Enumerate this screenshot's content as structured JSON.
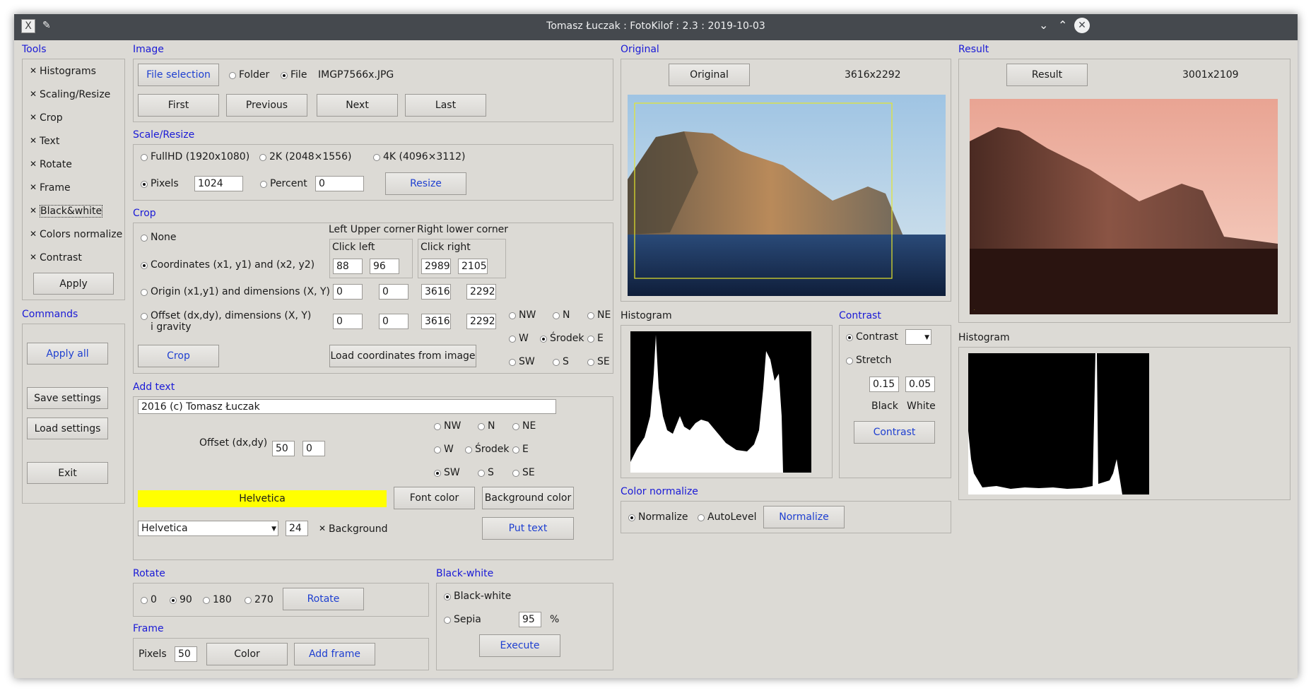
{
  "titlebar": {
    "title": "Tomasz Łuczak : FotoKilof : 2.3 : 2019-10-03"
  },
  "tools": {
    "heading": "Tools",
    "items": [
      "Histograms",
      "Scaling/Resize",
      "Crop",
      "Text",
      "Rotate",
      "Frame",
      "Black&white",
      "Colors normalize",
      "Contrast"
    ],
    "apply": "Apply"
  },
  "commands": {
    "heading": "Commands",
    "apply_all": "Apply all",
    "save_settings": "Save settings",
    "load_settings": "Load settings",
    "exit": "Exit"
  },
  "image": {
    "heading": "Image",
    "file_selection": "File selection",
    "folder": "Folder",
    "file": "File",
    "filename": "IMGP7566x.JPG",
    "first": "First",
    "previous": "Previous",
    "next": "Next",
    "last": "Last"
  },
  "scale": {
    "heading": "Scale/Resize",
    "fullhd": "FullHD (1920x1080)",
    "k2": "2K (2048×1556)",
    "k4": "4K (4096×3112)",
    "pixels": "Pixels",
    "pixels_value": "1024",
    "percent": "Percent",
    "percent_value": "0",
    "resize": "Resize"
  },
  "crop": {
    "heading": "Crop",
    "left_upper": "Left Upper corner",
    "right_lower": "Right lower corner",
    "click_left": "Click left",
    "click_right": "Click right",
    "none": "None",
    "coords": "Coordinates (x1, y1) and (x2, y2)",
    "origin": "Origin (x1,y1) and dimensions (X, Y)",
    "offset1": "Offset (dx,dy), dimensions (X, Y)",
    "offset2": "i gravity",
    "c_x1": "88",
    "c_y1": "96",
    "c_x2": "2989",
    "c_y2": "2105",
    "o_x": "0",
    "o_y": "0",
    "o_w": "3616",
    "o_h": "2292",
    "f_x": "0",
    "f_y": "0",
    "f_w": "3616",
    "f_h": "2292",
    "gravity": [
      "NW",
      "N",
      "NE",
      "W",
      "Środek",
      "E",
      "SW",
      "S",
      "SE"
    ],
    "crop_btn": "Crop",
    "load_coords": "Load coordinates from image"
  },
  "text": {
    "heading": "Add text",
    "value": "2016 (c) Tomasz Łuczak",
    "offset": "Offset (dx,dy)",
    "dx": "50",
    "dy": "0",
    "gravity": [
      "NW",
      "N",
      "NE",
      "W",
      "Środek",
      "E",
      "SW",
      "S",
      "SE"
    ],
    "font_preview": "Helvetica",
    "font_color": "Font color",
    "background_color": "Background color",
    "font": "Helvetica",
    "size": "24",
    "background": "Background",
    "put_text": "Put text"
  },
  "rotate": {
    "heading": "Rotate",
    "options": [
      "0",
      "90",
      "180",
      "270"
    ],
    "rotate": "Rotate"
  },
  "frame": {
    "heading": "Frame",
    "pixels": "Pixels",
    "value": "50",
    "color": "Color",
    "add": "Add frame"
  },
  "bw": {
    "heading": "Black-white",
    "bw": "Black-white",
    "sepia": "Sepia",
    "sepia_value": "95",
    "percent": "%",
    "execute": "Execute"
  },
  "original": {
    "heading": "Original",
    "button": "Original",
    "size": "3616x2292",
    "histogram": "Histogram"
  },
  "contrast": {
    "heading": "Contrast",
    "contrast": "Contrast",
    "stretch": "Stretch",
    "black_value": "0.15",
    "white_value": "0.05",
    "black": "Black",
    "white": "White",
    "button": "Contrast"
  },
  "normalize": {
    "heading": "Color normalize",
    "normalize": "Normalize",
    "autolevel": "AutoLevel",
    "button": "Normalize"
  },
  "result": {
    "heading": "Result",
    "button": "Result",
    "size": "3001x2109",
    "histogram": "Histogram"
  },
  "colors": {
    "accent": "#1a1ad6",
    "window": "#dcdad5",
    "titlebar": "#45494e",
    "font_preview_bg": "#ffff00"
  }
}
